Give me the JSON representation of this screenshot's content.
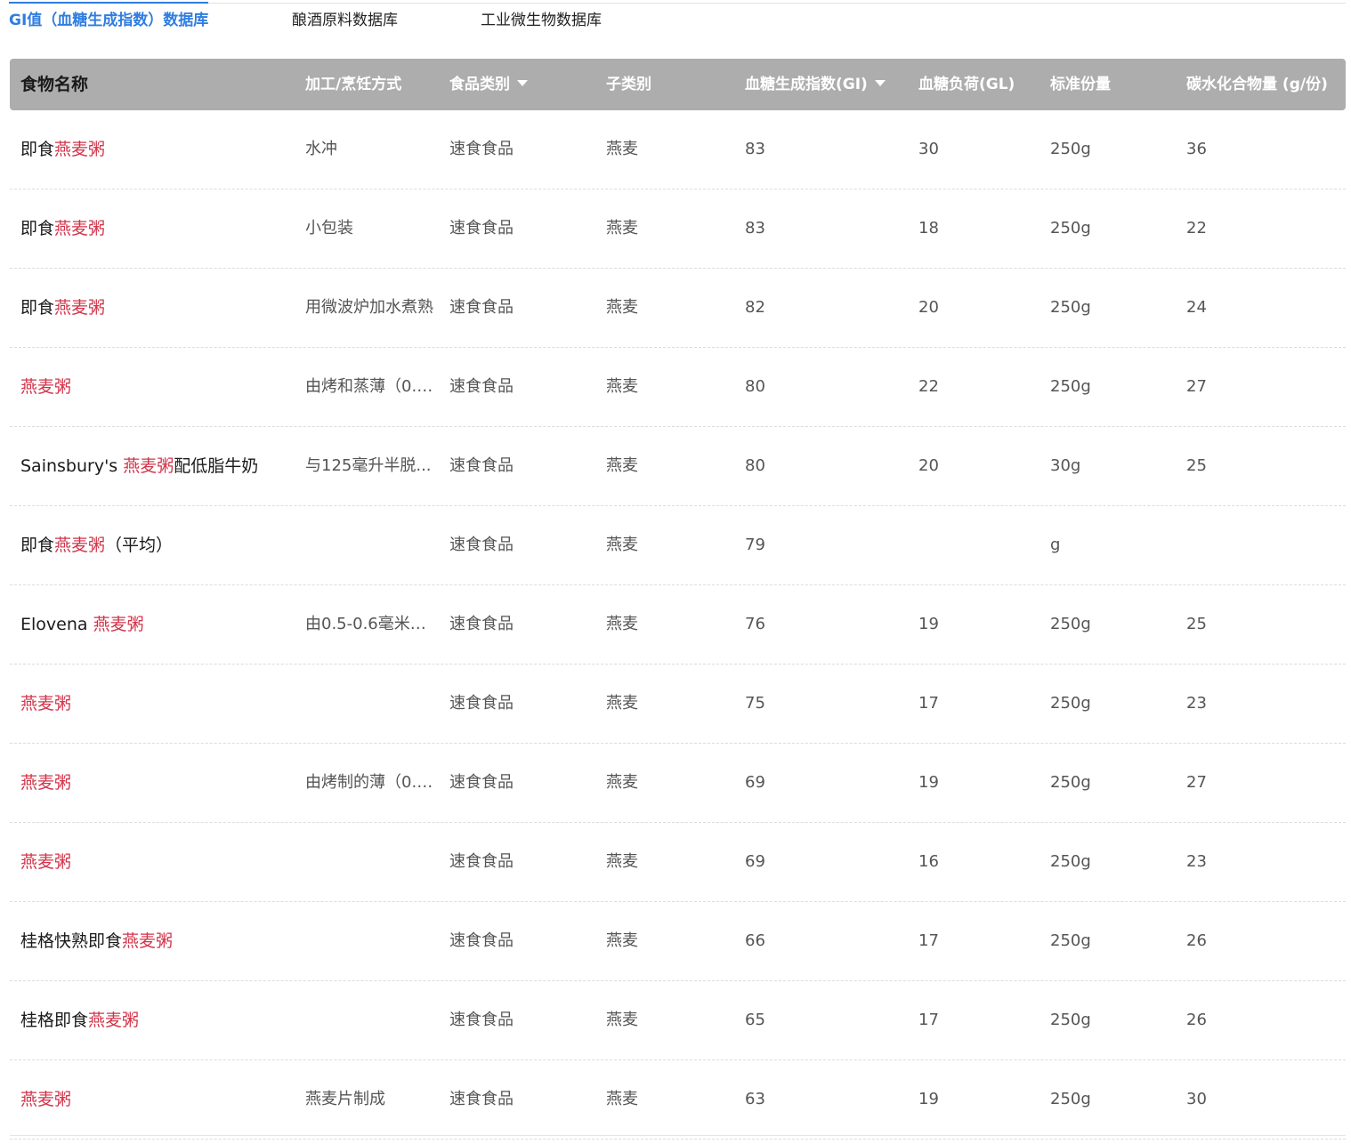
{
  "tabs": [
    {
      "label": "GI值（血糖生成指数）数据库",
      "active": true
    },
    {
      "label": "酿酒原料数据库",
      "active": false
    },
    {
      "label": "工业微生物数据库",
      "active": false
    }
  ],
  "columns": [
    {
      "label": "食物名称",
      "sortable": false
    },
    {
      "label": "加工/烹饪方式",
      "sortable": false
    },
    {
      "label": "食品类别",
      "sortable": true
    },
    {
      "label": "子类别",
      "sortable": false
    },
    {
      "label": "血糖生成指数(GI)",
      "sortable": true
    },
    {
      "label": "血糖负荷(GL)",
      "sortable": false
    },
    {
      "label": "标准份量",
      "sortable": false
    },
    {
      "label": "碳水化合物量 (g/份)",
      "sortable": false
    }
  ],
  "colors": {
    "accent": "#2f7de1",
    "highlight": "#d2344a",
    "header_bg": "#adadad"
  },
  "rows": [
    {
      "name": {
        "pre": "即食",
        "hl": "燕麦粥",
        "post": ""
      },
      "method": "水冲",
      "category": "速食食品",
      "subcategory": "燕麦",
      "gi": "83",
      "gl": "30",
      "portion": "250g",
      "carbs": "36"
    },
    {
      "name": {
        "pre": "即食",
        "hl": "燕麦粥",
        "post": ""
      },
      "method": "小包装",
      "category": "速食食品",
      "subcategory": "燕麦",
      "gi": "83",
      "gl": "18",
      "portion": "250g",
      "carbs": "22"
    },
    {
      "name": {
        "pre": "即食",
        "hl": "燕麦粥",
        "post": ""
      },
      "method": "用微波炉加水煮熟",
      "category": "速食食品",
      "subcategory": "燕麦",
      "gi": "82",
      "gl": "20",
      "portion": "250g",
      "carbs": "24"
    },
    {
      "name": {
        "pre": "",
        "hl": "燕麦粥",
        "post": ""
      },
      "method": "由烤和蒸薄（0.5...",
      "category": "速食食品",
      "subcategory": "燕麦",
      "gi": "80",
      "gl": "22",
      "portion": "250g",
      "carbs": "27"
    },
    {
      "name": {
        "pre": "Sainsbury's ",
        "hl": "燕麦粥",
        "post": "配低脂牛奶"
      },
      "method": "与125毫升半脱...",
      "category": "速食食品",
      "subcategory": "燕麦",
      "gi": "80",
      "gl": "20",
      "portion": "30g",
      "carbs": "25"
    },
    {
      "name": {
        "pre": "即食",
        "hl": "燕麦粥",
        "post": "（平均）"
      },
      "method": "",
      "category": "速食食品",
      "subcategory": "燕麦",
      "gi": "79",
      "gl": "",
      "portion": "g",
      "carbs": ""
    },
    {
      "name": {
        "pre": "Elovena ",
        "hl": "燕麦粥",
        "post": ""
      },
      "method": "由0.5-0.6毫米厚...",
      "category": "速食食品",
      "subcategory": "燕麦",
      "gi": "76",
      "gl": "19",
      "portion": "250g",
      "carbs": "25"
    },
    {
      "name": {
        "pre": "",
        "hl": "燕麦粥",
        "post": ""
      },
      "method": "",
      "category": "速食食品",
      "subcategory": "燕麦",
      "gi": "75",
      "gl": "17",
      "portion": "250g",
      "carbs": "23"
    },
    {
      "name": {
        "pre": "",
        "hl": "燕麦粥",
        "post": ""
      },
      "method": "由烤制的薄（0.5...",
      "category": "速食食品",
      "subcategory": "燕麦",
      "gi": "69",
      "gl": "19",
      "portion": "250g",
      "carbs": "27"
    },
    {
      "name": {
        "pre": "",
        "hl": "燕麦粥",
        "post": ""
      },
      "method": "",
      "category": "速食食品",
      "subcategory": "燕麦",
      "gi": "69",
      "gl": "16",
      "portion": "250g",
      "carbs": "23"
    },
    {
      "name": {
        "pre": "桂格快熟即食",
        "hl": "燕麦粥",
        "post": ""
      },
      "method": "",
      "category": "速食食品",
      "subcategory": "燕麦",
      "gi": "66",
      "gl": "17",
      "portion": "250g",
      "carbs": "26"
    },
    {
      "name": {
        "pre": "桂格即食",
        "hl": "燕麦粥",
        "post": ""
      },
      "method": "",
      "category": "速食食品",
      "subcategory": "燕麦",
      "gi": "65",
      "gl": "17",
      "portion": "250g",
      "carbs": "26"
    },
    {
      "name": {
        "pre": "",
        "hl": "燕麦粥",
        "post": ""
      },
      "method": "燕麦片制成",
      "category": "速食食品",
      "subcategory": "燕麦",
      "gi": "63",
      "gl": "19",
      "portion": "250g",
      "carbs": "30"
    }
  ]
}
